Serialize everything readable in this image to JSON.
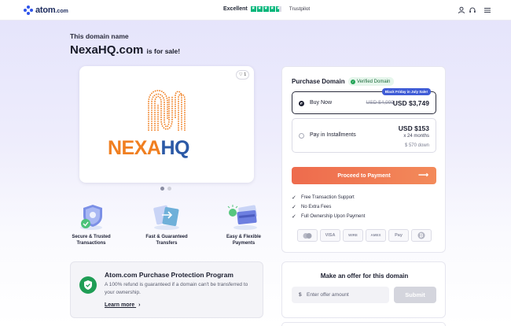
{
  "header": {
    "logo_word": "atom",
    "logo_tld": ".com",
    "trust_excellent": "Excellent",
    "trust_name": "Trustpilot",
    "brand_color": "#2f54eb",
    "trust_color": "#00b67a"
  },
  "hero": {
    "eyebrow": "This domain name",
    "domain": "NexaHQ.com",
    "suffix": "is for sale!"
  },
  "image_card": {
    "favorites_count": "1",
    "brand_left": "NEXA",
    "brand_right": "HQ",
    "brand_left_color": "#f07f21",
    "brand_right_color": "#2b59a6",
    "carousel_slides": 2,
    "active_slide": 1
  },
  "features": [
    {
      "line1": "Secure & Trusted",
      "line2": "Transactions",
      "icon": "shield-check-icon"
    },
    {
      "line1": "Fast & Guaranteed",
      "line2": "Transfers",
      "icon": "transfer-icon"
    },
    {
      "line1": "Easy & Flexible",
      "line2": "Payments",
      "icon": "credit-card-icon"
    }
  ],
  "protection": {
    "title": "Atom.com Purchase Protection Program",
    "description": "A 100% refund is guaranteed if a domain can't be transferred to your ownership.",
    "link": "Learn more"
  },
  "purchase": {
    "title": "Purchase Domain",
    "verified": "Verified Domain",
    "buy_now": {
      "badge": "Black Friday in July Sale!",
      "label": "Buy Now",
      "old_price": "USD $4,999",
      "price": "USD $3,749",
      "selected": true
    },
    "installments": {
      "label": "Pay in Installments",
      "price": "USD $153",
      "terms": "x 24 months",
      "down": "$ 570 down",
      "selected": false
    },
    "cta": "Proceed to Payment",
    "checks": [
      "Free Transaction Support",
      "No Extra Fees",
      "Full Ownership Upon Payment"
    ],
    "payments": [
      "mastercard-icon",
      "VISA",
      "WIRE",
      "AMEX",
      "Pay",
      "bitcoin-icon"
    ]
  },
  "offer": {
    "title": "Make an offer for this domain",
    "currency": "$",
    "placeholder": "Enter offer amount",
    "submit": "Submit"
  }
}
